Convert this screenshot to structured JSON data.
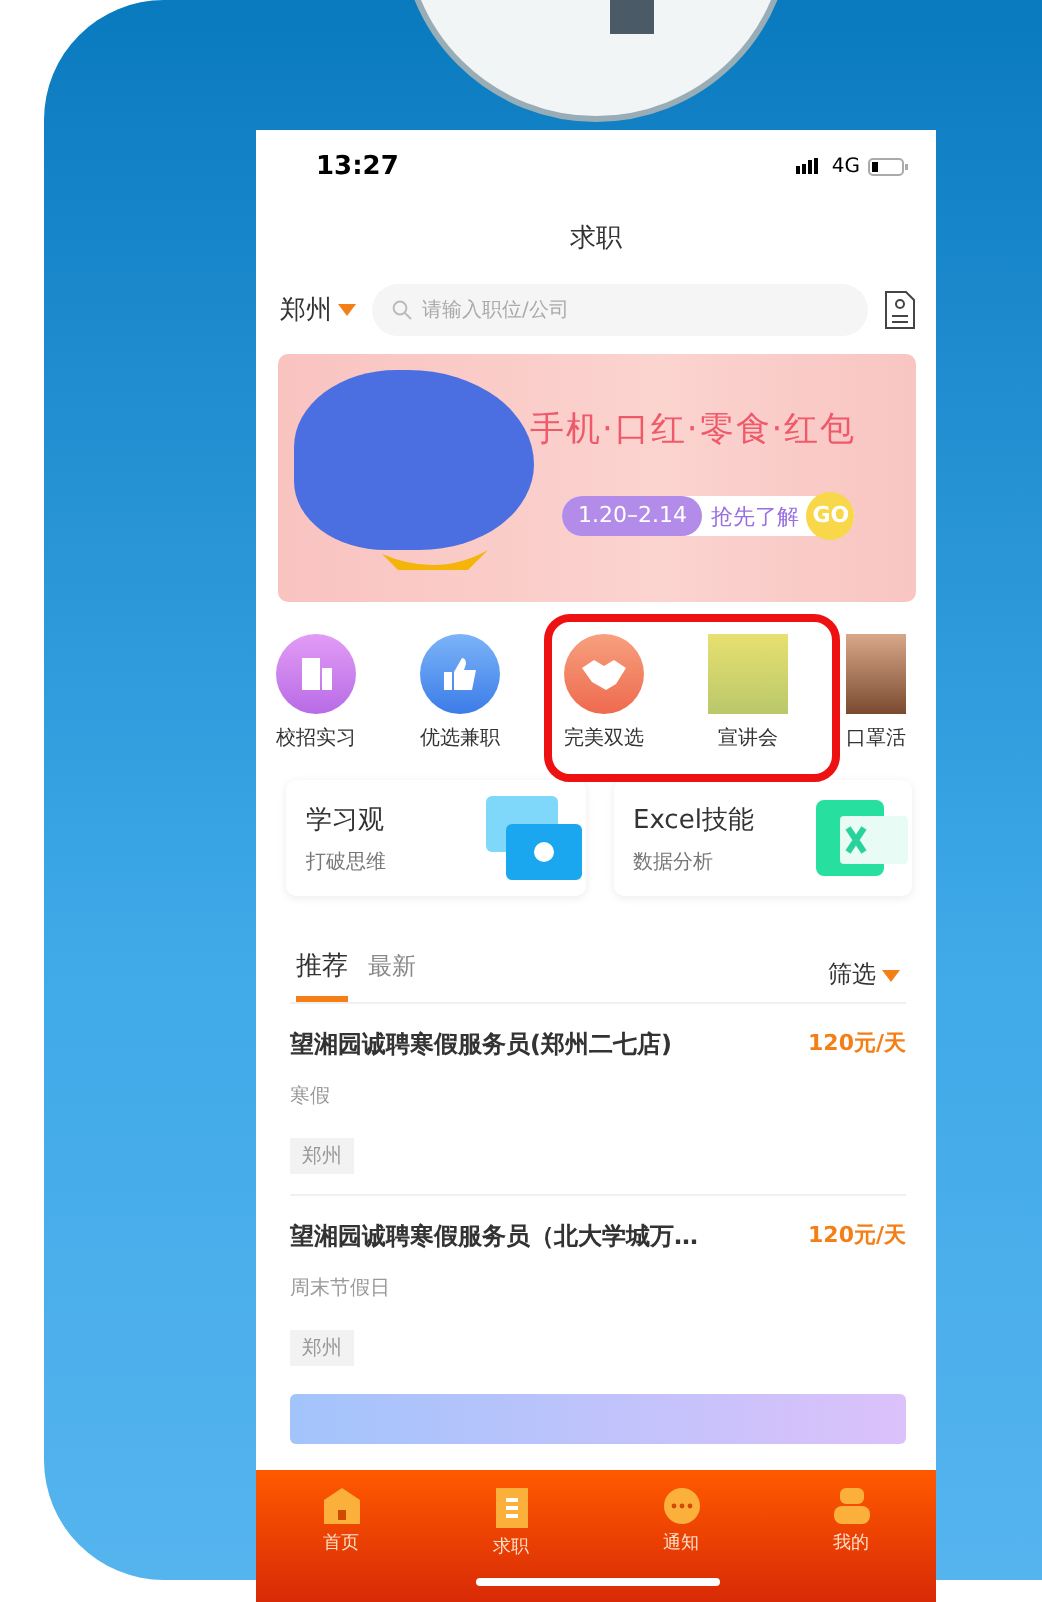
{
  "status_bar": {
    "time": "13:27",
    "network": "4G"
  },
  "header": {
    "title": "求职"
  },
  "search": {
    "city": "郑州",
    "placeholder": "请输入职位/公司"
  },
  "banner": {
    "headline": "手机·口红·零食·红包",
    "dates": "1.20–2.14",
    "cta": "抢先了解",
    "go": "GO"
  },
  "shortcuts": [
    {
      "label": "校招实习",
      "kind": "building"
    },
    {
      "label": "优选兼职",
      "kind": "thumb"
    },
    {
      "label": "完美双选",
      "kind": "handshake"
    },
    {
      "label": "宣讲会",
      "kind": "photo"
    },
    {
      "label": "口罩活",
      "kind": "photo"
    }
  ],
  "courses": [
    {
      "title": "学习观",
      "subtitle": "打破思维",
      "kind": "video"
    },
    {
      "title": "Excel技能",
      "subtitle": "数据分析",
      "kind": "excel"
    }
  ],
  "tabs": [
    {
      "label": "推荐",
      "selected": true
    },
    {
      "label": "最新",
      "selected": false
    }
  ],
  "filter": {
    "label": "筛选"
  },
  "jobs": [
    {
      "title": "望湘园诚聘寒假服务员(郑州二七店)",
      "salary": "120元/天",
      "period": "寒假",
      "location": "郑州"
    },
    {
      "title": "望湘园诚聘寒假服务员（北大学城万…",
      "salary": "120元/天",
      "period": "周末节假日",
      "location": "郑州"
    }
  ],
  "bottom_nav": [
    {
      "label": "首页",
      "kind": "home"
    },
    {
      "label": "求职",
      "kind": "scroll"
    },
    {
      "label": "通知",
      "kind": "chat"
    },
    {
      "label": "我的",
      "kind": "person"
    }
  ]
}
